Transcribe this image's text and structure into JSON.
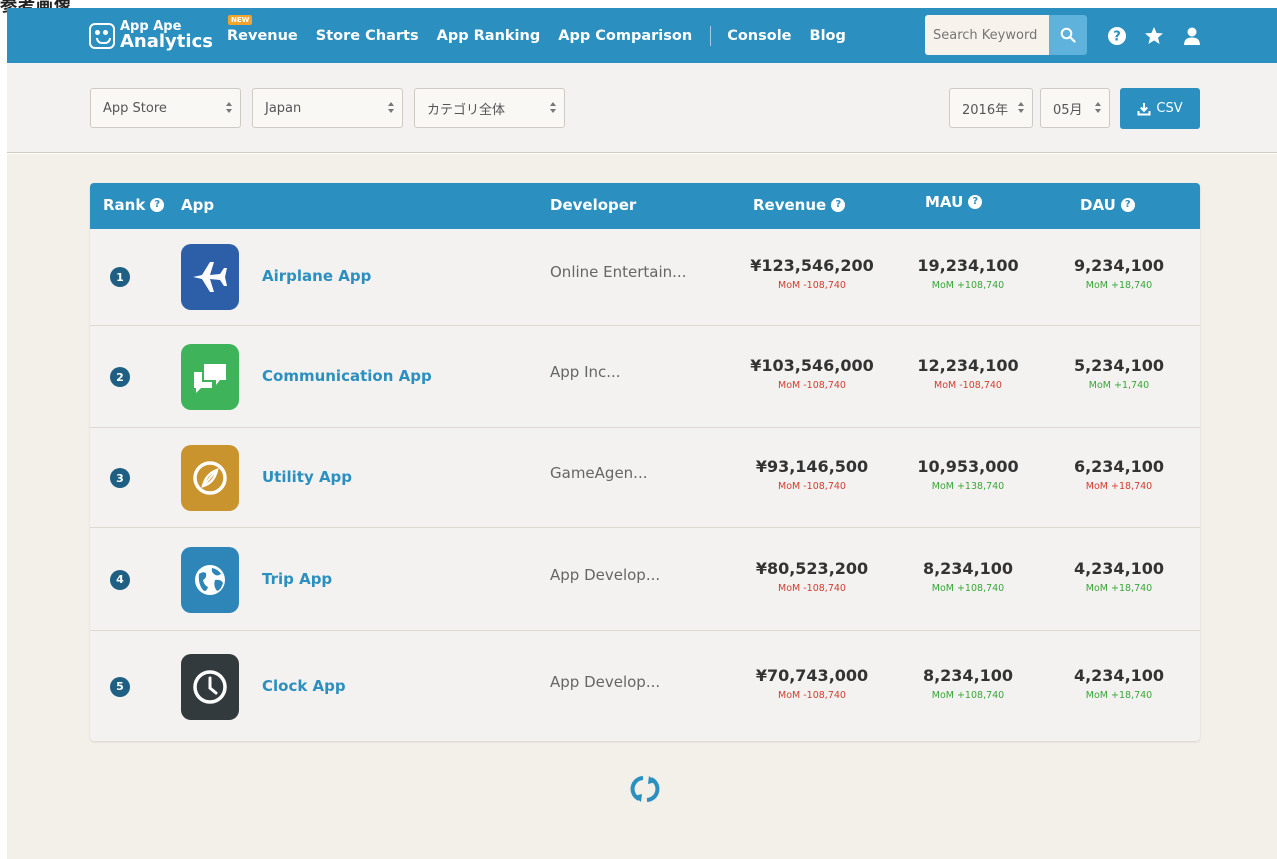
{
  "corner_label": "参考画像",
  "header": {
    "logo_line1": "App Ape",
    "logo_line2": "Analytics",
    "new_badge": "NEW",
    "nav": [
      "Revenue",
      "Store Charts",
      "App Ranking",
      "App Comparison",
      "Console",
      "Blog"
    ],
    "search_placeholder": "Search Keyword",
    "icons": [
      "search-icon",
      "help-icon",
      "star-icon",
      "user-icon"
    ],
    "accent_color": "#2b8fc0"
  },
  "filters": {
    "store": "App Store",
    "country": "Japan",
    "category": "カテゴリ全体",
    "year": "2016年",
    "month": "05月",
    "csv_label": "CSV"
  },
  "table": {
    "headers": {
      "rank": "Rank",
      "app": "App",
      "developer": "Developer",
      "revenue": "Revenue",
      "mau": "MAU",
      "dau": "DAU"
    },
    "rows": [
      {
        "rank": "1",
        "icon": "airplane-icon",
        "icon_color": "#2d5fa8",
        "name": "Airplane App",
        "developer": "Online Entertain...",
        "revenue": "¥123,546,200",
        "revenue_mom": "MoM -108,740",
        "revenue_trend": "neg",
        "mau": "19,234,100",
        "mau_mom": "MoM +108,740",
        "mau_trend": "pos",
        "dau": "9,234,100",
        "dau_mom": "MoM +18,740",
        "dau_trend": "pos"
      },
      {
        "rank": "2",
        "icon": "chat-icon",
        "icon_color": "#3fb35a",
        "name": "Communication App",
        "developer": "App Inc...",
        "revenue": "¥103,546,000",
        "revenue_mom": "MoM -108,740",
        "revenue_trend": "neg",
        "mau": "12,234,100",
        "mau_mom": "MoM -108,740",
        "mau_trend": "neg",
        "dau": "5,234,100",
        "dau_mom": "MoM +1,740",
        "dau_trend": "pos"
      },
      {
        "rank": "3",
        "icon": "compass-icon",
        "icon_color": "#c9932e",
        "name": "Utility App",
        "developer": "GameAgen...",
        "revenue": "¥93,146,500",
        "revenue_mom": "MoM -108,740",
        "revenue_trend": "neg",
        "mau": "10,953,000",
        "mau_mom": "MoM +138,740",
        "mau_trend": "pos",
        "dau": "6,234,100",
        "dau_mom": "MoM +18,740",
        "dau_trend": "neg"
      },
      {
        "rank": "4",
        "icon": "globe-icon",
        "icon_color": "#2e86b8",
        "name": "Trip App",
        "developer": "App Develop...",
        "revenue": "¥80,523,200",
        "revenue_mom": "MoM -108,740",
        "revenue_trend": "neg",
        "mau": "8,234,100",
        "mau_mom": "MoM +108,740",
        "mau_trend": "pos",
        "dau": "4,234,100",
        "dau_mom": "MoM +18,740",
        "dau_trend": "pos"
      },
      {
        "rank": "5",
        "icon": "clock-icon",
        "icon_color": "#333a3e",
        "name": "Clock App",
        "developer": "App Develop...",
        "revenue": "¥70,743,000",
        "revenue_mom": "MoM -108,740",
        "revenue_trend": "neg",
        "mau": "8,234,100",
        "mau_mom": "MoM +108,740",
        "mau_trend": "pos",
        "dau": "4,234,100",
        "dau_mom": "MoM +18,740",
        "dau_trend": "pos"
      }
    ]
  },
  "footer": {
    "reload_icon": "reload-icon"
  }
}
